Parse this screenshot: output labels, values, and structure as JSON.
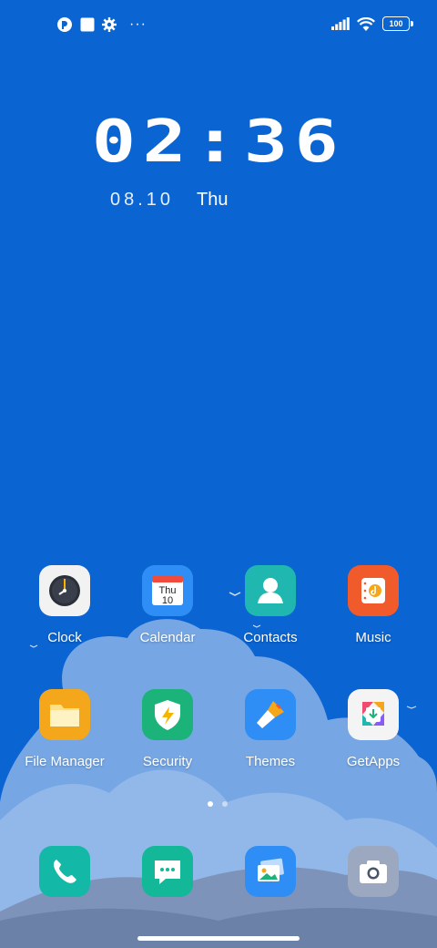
{
  "status_bar": {
    "left_icons": [
      "notification-app-icon",
      "square-notification-icon",
      "settings-gear-icon"
    ],
    "more_indicator": "···",
    "battery_level": "100",
    "signal": "full",
    "wifi": "connected"
  },
  "clock_widget": {
    "time": "02:36",
    "date": "08.10",
    "weekday": "Thu"
  },
  "apps": {
    "clock": {
      "label": "Clock",
      "icon": "clock-icon"
    },
    "calendar": {
      "label": "Calendar",
      "icon": "calendar-icon",
      "icon_day": "Thu",
      "icon_date": "10"
    },
    "contacts": {
      "label": "Contacts",
      "icon": "contacts-icon"
    },
    "music": {
      "label": "Music",
      "icon": "music-icon"
    },
    "file_manager": {
      "label": "File Manager",
      "icon": "folder-icon"
    },
    "security": {
      "label": "Security",
      "icon": "shield-icon"
    },
    "themes": {
      "label": "Themes",
      "icon": "paintbrush-icon"
    },
    "getapps": {
      "label": "GetApps",
      "icon": "getapps-icon"
    }
  },
  "dock": [
    "phone-icon",
    "messages-icon",
    "gallery-icon",
    "camera-icon"
  ],
  "page_indicator": {
    "pages": 2,
    "current": 1
  },
  "colors": {
    "background": "#0a64d2",
    "clock": "#f2f2f2",
    "calendar": "#2f8ef5",
    "contacts": "#1fb7b0",
    "music": "#f15b2b",
    "file_manager": "#f4a71a",
    "security": "#1cb37a",
    "themes": "#2f8ef5",
    "getapps": "#f4f4f4",
    "phone": "#14b8a6",
    "messages": "#12b898",
    "gallery": "#2f8ef5",
    "camera": "#9ca8bf"
  }
}
